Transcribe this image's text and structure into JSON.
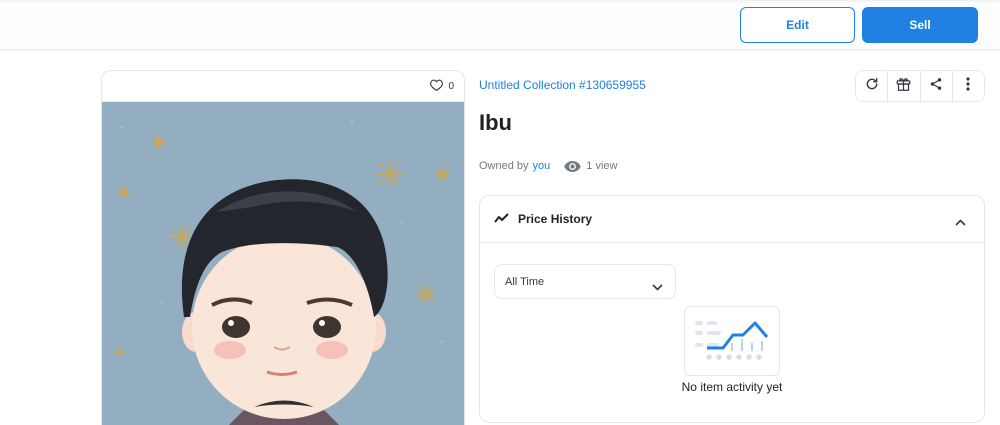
{
  "topbar": {
    "edit_label": "Edit",
    "sell_label": "Sell"
  },
  "item": {
    "favorites_count": "0",
    "collection_name": "Untitled Collection #130659955",
    "title": "Ibu",
    "owned_by_label": "Owned by",
    "owner": "you",
    "views": "1 view"
  },
  "actions": [
    "refresh-icon",
    "gift-icon",
    "share-icon",
    "more-icon"
  ],
  "price_history": {
    "title": "Price History",
    "filter_value": "All Time",
    "empty_text": "No item activity yet"
  },
  "colors": {
    "accent": "#2081e2",
    "border": "#e5e8eb",
    "text": "#353840",
    "muted": "#707a83",
    "art_bg": "#93aec0"
  }
}
